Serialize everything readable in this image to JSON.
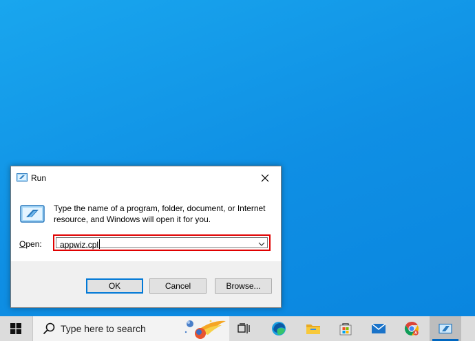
{
  "dialog": {
    "title": "Run",
    "description": "Type the name of a program, folder, document, or Internet resource, and Windows will open it for you.",
    "open_label_first": "O",
    "open_label_rest": "pen:",
    "open_value": "appwiz.cpl",
    "buttons": {
      "ok": "OK",
      "cancel": "Cancel",
      "browse": "Browse..."
    }
  },
  "taskbar": {
    "search_placeholder": "Type here to search"
  },
  "colors": {
    "desktop": "#1aa1ec",
    "highlight_border": "#e00000",
    "taskbar": "#dcdcdc"
  }
}
